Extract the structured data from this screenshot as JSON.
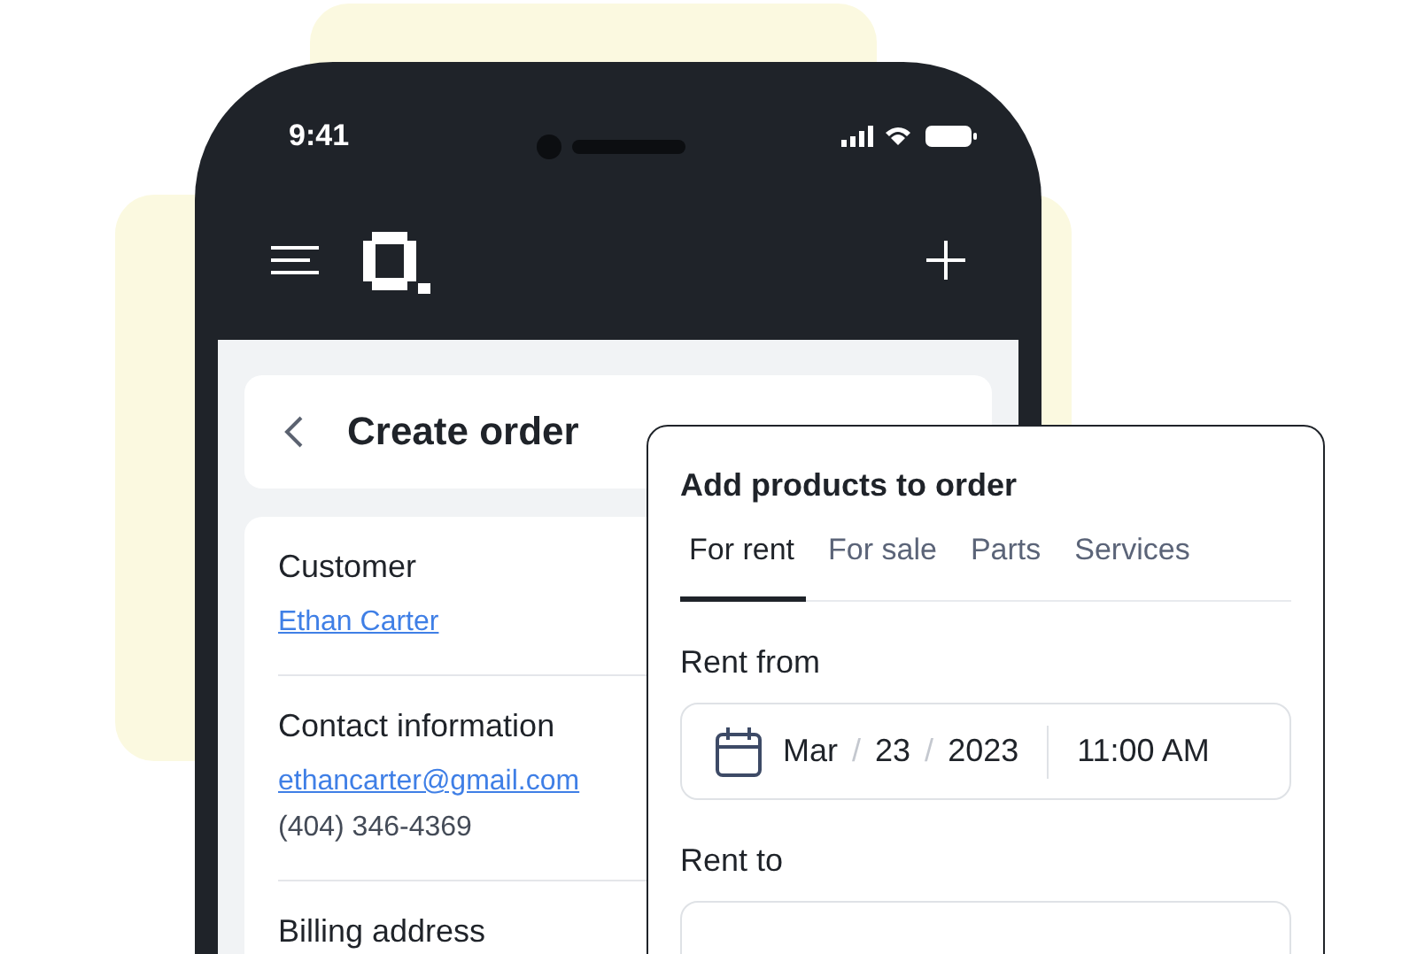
{
  "status_bar": {
    "time": "9:41"
  },
  "page_header": {
    "title": "Create order"
  },
  "sections": [
    {
      "heading": "Customer",
      "lines": [
        {
          "text": "Ethan Carter",
          "kind": "link"
        }
      ]
    },
    {
      "heading": "Contact information",
      "lines": [
        {
          "text": "ethancarter@gmail.com",
          "kind": "link"
        },
        {
          "text": "(404) 346-4369",
          "kind": "plain"
        }
      ]
    },
    {
      "heading": "Billing address"
    }
  ],
  "popup": {
    "title": "Add products to order",
    "tabs": [
      {
        "label": "For rent",
        "selected": true
      },
      {
        "label": "For sale",
        "selected": false
      },
      {
        "label": "Parts",
        "selected": false
      },
      {
        "label": "Services",
        "selected": false
      }
    ],
    "fields": [
      {
        "label": "Rent from",
        "month": "Mar",
        "day": "23",
        "year": "2023",
        "separator": "/",
        "time": "11:00 AM"
      },
      {
        "label": "Rent to"
      }
    ]
  }
}
